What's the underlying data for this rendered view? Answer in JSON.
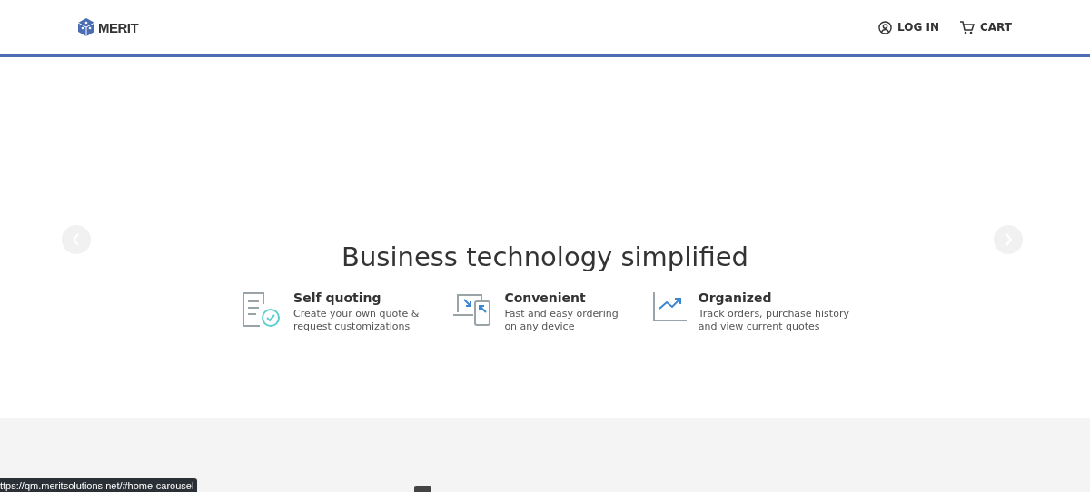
{
  "header": {
    "logo_text": "MERIT",
    "nav": [
      {
        "kind": "login",
        "label": "LOG IN"
      },
      {
        "kind": "cart",
        "label": "CART"
      }
    ]
  },
  "hero": {
    "title": "Business technology simplified",
    "features": [
      {
        "kind": "quote",
        "title": "Self quoting",
        "text": [
          "Create your own quote &",
          "request customizations"
        ]
      },
      {
        "kind": "device",
        "title": "Convenient",
        "text": [
          "Fast and easy ordering",
          "on any device"
        ]
      },
      {
        "kind": "chart",
        "title": "Organized",
        "text": [
          "Track orders, purchase history",
          "and view current quotes"
        ]
      }
    ]
  },
  "status_bar": {
    "url": "ttps://qm.meritsolutions.net/#home-carousel"
  }
}
